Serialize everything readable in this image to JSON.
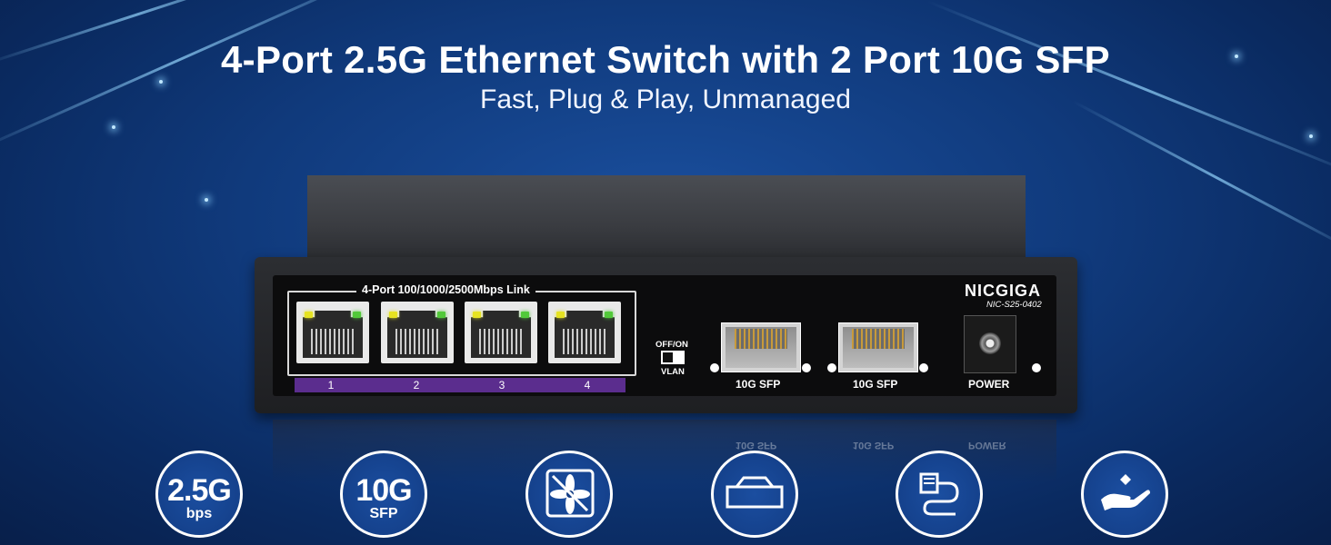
{
  "banner": {
    "title": "4-Port 2.5G Ethernet Switch with 2 Port 10G SFP",
    "subtitle": "Fast, Plug & Play, Unmanaged"
  },
  "device": {
    "brand": "NICGIGA",
    "model": "NIC-S25-0402",
    "rj45_group_label": "4-Port 100/1000/2500Mbps Link",
    "rj45_ports": [
      "1",
      "2",
      "3",
      "4"
    ],
    "switch_top_label": "OFF/ON",
    "switch_bottom_label": "VLAN",
    "sfp_ports": [
      "10G SFP",
      "10G SFP"
    ],
    "power_label": "POWER"
  },
  "features": [
    {
      "icon": "speed-2-5g-icon",
      "main": "2.5G",
      "sub": "bps"
    },
    {
      "icon": "sfp-10g-icon",
      "main": "10G",
      "sub": "SFP"
    },
    {
      "icon": "fanless-icon"
    },
    {
      "icon": "metal-case-icon"
    },
    {
      "icon": "plug-and-play-icon"
    },
    {
      "icon": "hand-care-icon"
    }
  ]
}
